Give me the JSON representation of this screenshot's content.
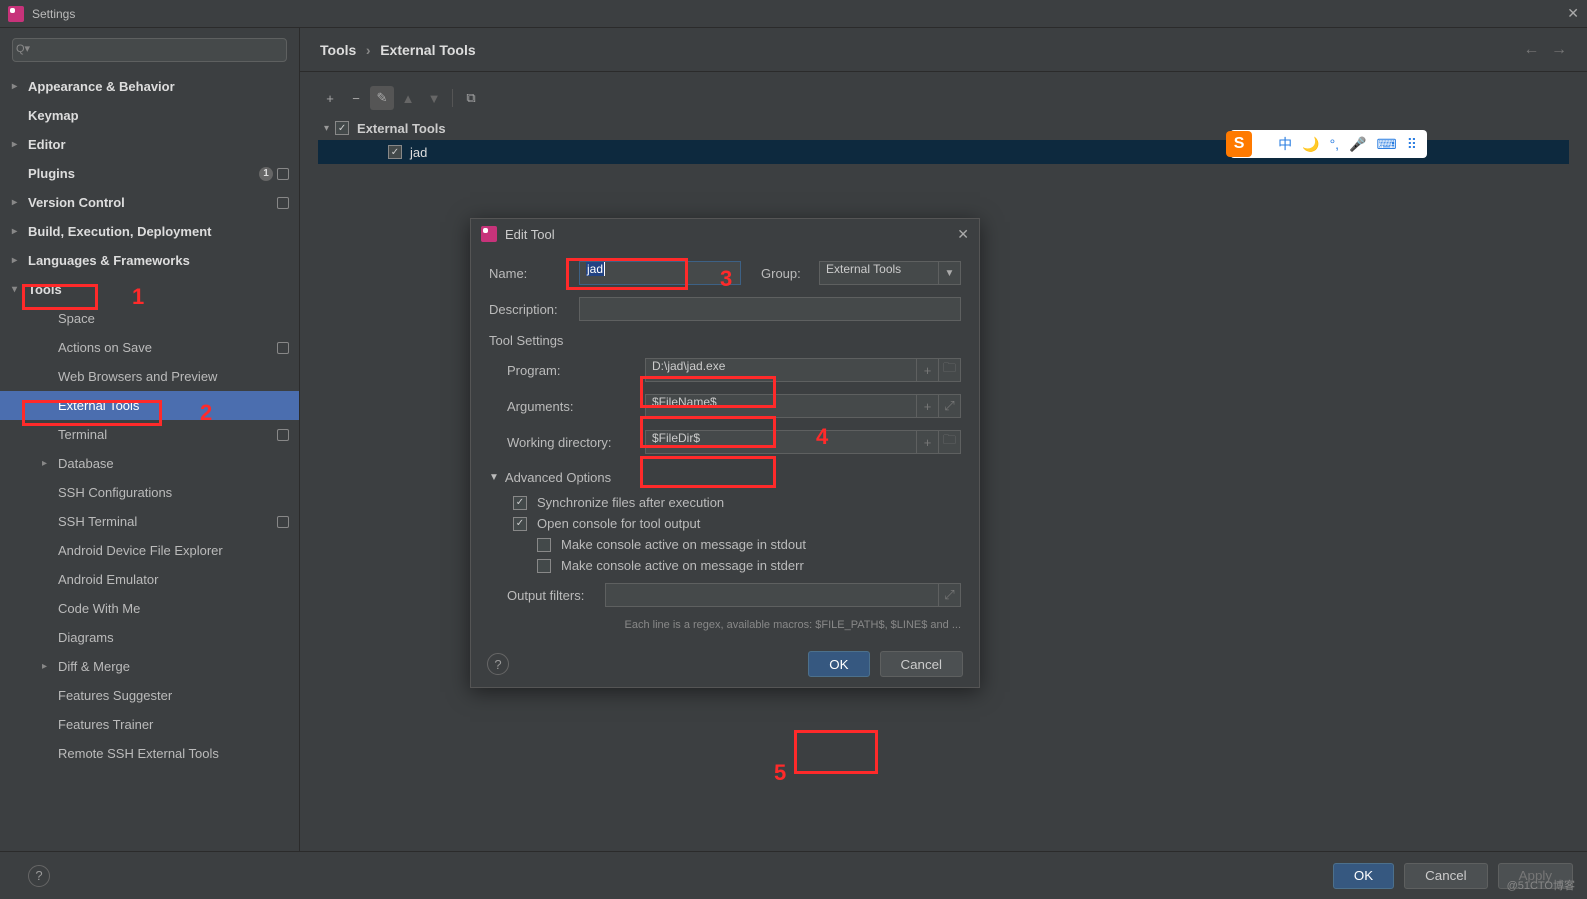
{
  "window": {
    "title": "Settings"
  },
  "search": {
    "placeholder": ""
  },
  "sidebar": {
    "items": [
      {
        "label": "Appearance & Behavior",
        "bold": true,
        "caret": ">"
      },
      {
        "label": "Keymap",
        "bold": true
      },
      {
        "label": "Editor",
        "bold": true,
        "caret": ">"
      },
      {
        "label": "Plugins",
        "bold": true,
        "badge": "1",
        "sq": true
      },
      {
        "label": "Version Control",
        "bold": true,
        "caret": ">",
        "sq": true
      },
      {
        "label": "Build, Execution, Deployment",
        "bold": true,
        "caret": ">"
      },
      {
        "label": "Languages & Frameworks",
        "bold": true,
        "caret": ">"
      },
      {
        "label": "Tools",
        "bold": true,
        "caret": "v"
      },
      {
        "label": "Space",
        "level": 2
      },
      {
        "label": "Actions on Save",
        "level": 2,
        "sq": true
      },
      {
        "label": "Web Browsers and Preview",
        "level": 2
      },
      {
        "label": "External Tools",
        "level": 2,
        "selected": true
      },
      {
        "label": "Terminal",
        "level": 2,
        "sq": true
      },
      {
        "label": "Database",
        "level": 2,
        "caret": ">"
      },
      {
        "label": "SSH Configurations",
        "level": 2
      },
      {
        "label": "SSH Terminal",
        "level": 2,
        "sq": true
      },
      {
        "label": "Android Device File Explorer",
        "level": 2
      },
      {
        "label": "Android Emulator",
        "level": 2
      },
      {
        "label": "Code With Me",
        "level": 2
      },
      {
        "label": "Diagrams",
        "level": 2
      },
      {
        "label": "Diff & Merge",
        "level": 2,
        "caret": ">"
      },
      {
        "label": "Features Suggester",
        "level": 2
      },
      {
        "label": "Features Trainer",
        "level": 2
      },
      {
        "label": "Remote SSH External Tools",
        "level": 2
      }
    ]
  },
  "breadcrumb": {
    "segments": [
      "Tools",
      "External Tools"
    ],
    "sep": "›"
  },
  "toolbar": {
    "add": "+",
    "remove": "−",
    "edit": "✎",
    "up": "▲",
    "down": "▼",
    "copy": "⧉"
  },
  "tools": {
    "group_label": "External Tools",
    "item": "jad"
  },
  "modal": {
    "title": "Edit Tool",
    "name_label": "Name:",
    "name_value": "jad",
    "group_label": "Group:",
    "group_value": "External Tools",
    "desc_label": "Description:",
    "desc_value": "",
    "tool_settings_label": "Tool Settings",
    "program_label": "Program:",
    "program_value": "D:\\jad\\jad.exe",
    "arguments_label": "Arguments:",
    "arguments_value": "$FileName$",
    "workdir_label": "Working directory:",
    "workdir_value": "$FileDir$",
    "advanced_label": "Advanced Options",
    "sync_label": "Synchronize files after execution",
    "console_label": "Open console for tool output",
    "stdout_label": "Make console active on message in stdout",
    "stderr_label": "Make console active on message in stderr",
    "filters_label": "Output filters:",
    "filters_hint": "Each line is a regex, available macros: $FILE_PATH$, $LINE$ and ...",
    "ok": "OK",
    "cancel": "Cancel"
  },
  "footer": {
    "ok": "OK",
    "cancel": "Cancel",
    "apply": "Apply"
  },
  "annotations": {
    "n1": "1",
    "n2": "2",
    "n3": "3",
    "n4": "4",
    "n5": "5"
  },
  "ime": {
    "lang": "中",
    "moon": "🌙",
    "punct": "°,",
    "mic": "🎤",
    "kbd": "⌨",
    "grid": "⠿"
  },
  "watermark": "@51CTO博客"
}
